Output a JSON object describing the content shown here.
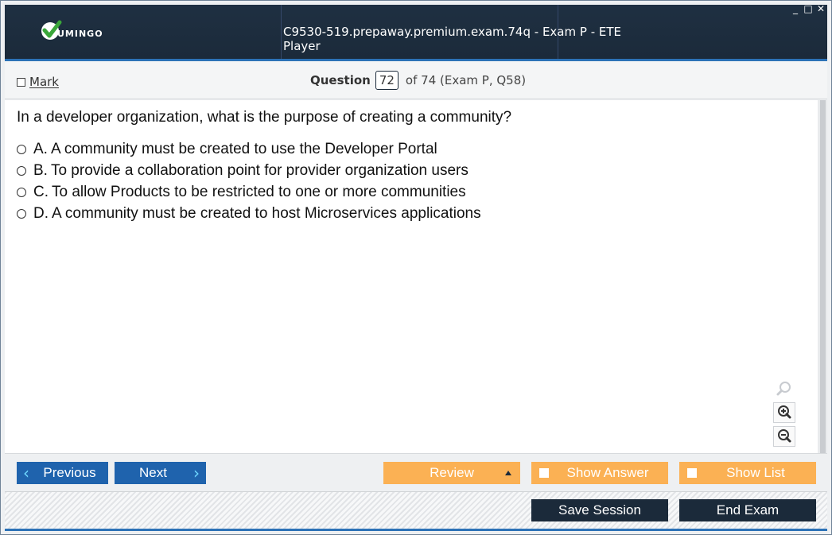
{
  "window": {
    "title": "C9530-519.prepaway.premium.exam.74q - Exam P - ETE Player",
    "logo_text": "UMINGO",
    "controls": {
      "minimize": "_",
      "maximize": "□",
      "close": "✕"
    }
  },
  "header": {
    "mark_label": "Mark",
    "question_word": "Question",
    "question_number": "72",
    "question_of": "of 74 (Exam P, Q58)"
  },
  "question": {
    "text": "In a developer organization, what is the purpose of creating a community?",
    "options": [
      {
        "letter": "A.",
        "text": "A community must be created to use the Developer Portal"
      },
      {
        "letter": "B.",
        "text": "To provide a collaboration point for provider organization users"
      },
      {
        "letter": "C.",
        "text": "To allow Products to be restricted to one or more communities"
      },
      {
        "letter": "D.",
        "text": "A community must be created to host Microservices applications"
      }
    ]
  },
  "nav": {
    "previous": "Previous",
    "next": "Next",
    "review": "Review",
    "show_answer": "Show Answer",
    "show_list": "Show List"
  },
  "footer": {
    "save_session": "Save Session",
    "end_exam": "End Exam"
  },
  "colors": {
    "titlebar": "#1b2a3a",
    "accent": "#2c72b7",
    "nav_blue": "#1f63ad",
    "orange": "#fbb154",
    "dark_button": "#1b2a3a"
  }
}
